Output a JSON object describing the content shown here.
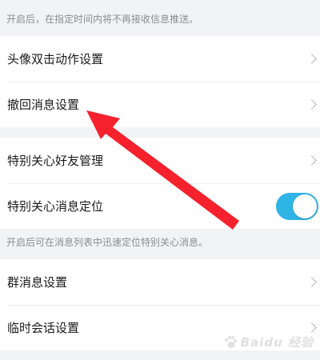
{
  "notes": {
    "do_not_disturb": "开启后，在指定时间内将不再接收信息推送。",
    "special_care_locate": "开启后可在消息列表中迅速定位特别关心消息。"
  },
  "group1": {
    "items": [
      {
        "label": "头像双击动作设置",
        "icon": "chevron-right-icon"
      },
      {
        "label": "撤回消息设置",
        "icon": "chevron-right-icon"
      }
    ]
  },
  "group2": {
    "items": [
      {
        "label": "特别关心好友管理",
        "icon": "chevron-right-icon"
      },
      {
        "label": "特别关心消息定位",
        "toggle": true
      }
    ]
  },
  "group3": {
    "items": [
      {
        "label": "群消息设置",
        "icon": "chevron-right-icon"
      },
      {
        "label": "临时会话设置",
        "icon": "chevron-right-icon"
      }
    ]
  },
  "colors": {
    "background": "#f2f3f7",
    "toggle_on": "#2eb5e6",
    "annotation_arrow": "#f5222d"
  },
  "watermark": {
    "text": "Baidu 经验"
  }
}
